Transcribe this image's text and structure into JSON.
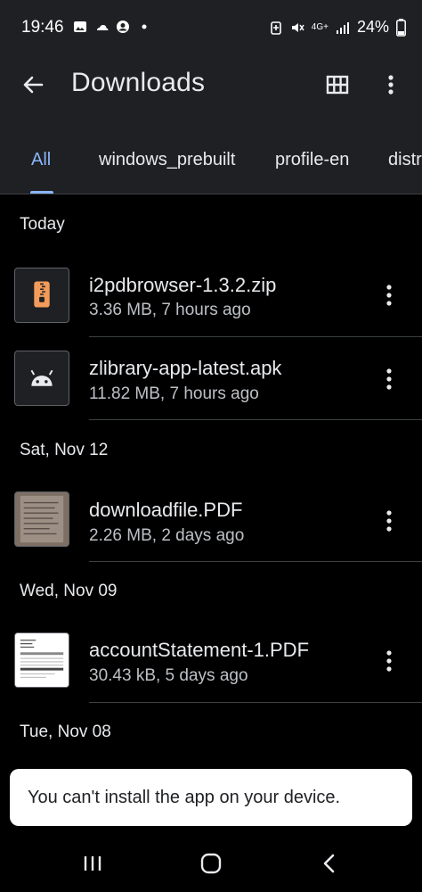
{
  "status_bar": {
    "time": "19:46",
    "battery": "24%",
    "network": "4G+"
  },
  "app_bar": {
    "title": "Downloads",
    "icons": [
      "back-arrow-icon",
      "grid-view-icon",
      "more-vert-icon"
    ]
  },
  "tabs": [
    "All",
    "windows_prebuilt",
    "profile-en",
    "distr"
  ],
  "active_tab": "All",
  "sections": [
    {
      "label": "Today",
      "files": [
        {
          "name": "i2pdbrowser-1.3.2.zip",
          "meta": "3.36 MB, 7 hours ago",
          "icon": "zip-icon"
        },
        {
          "name": "zlibrary-app-latest.apk",
          "meta": "11.82 MB, 7 hours ago",
          "icon": "android-icon"
        }
      ]
    },
    {
      "label": "Sat, Nov 12",
      "files": [
        {
          "name": "downloadfile.PDF",
          "meta": "2.26 MB, 2 days ago",
          "icon": "pdf-thumbnail"
        }
      ]
    },
    {
      "label": "Wed, Nov 09",
      "files": [
        {
          "name": "accountStatement-1.PDF",
          "meta": "30.43 kB, 5 days ago",
          "icon": "pdf-thumbnail"
        }
      ]
    },
    {
      "label": "Tue, Nov 08",
      "files": []
    }
  ],
  "toast": "You can't install the app on your device.",
  "nav_bar": [
    "recents-icon",
    "home-icon",
    "back-icon"
  ],
  "colors": {
    "accent": "#8ab4f8",
    "zip": "#f29b5a",
    "surface": "#1f2023"
  }
}
